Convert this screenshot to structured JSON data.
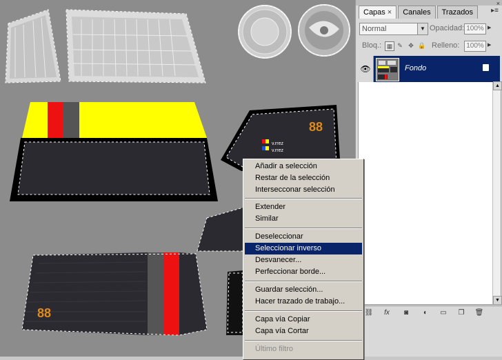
{
  "panel": {
    "tabs": [
      {
        "label": "Capas",
        "close": "×",
        "active": true
      },
      {
        "label": "Canales",
        "active": false
      },
      {
        "label": "Trazados",
        "active": false
      }
    ],
    "menu_glyph": "▸≡",
    "close_glyph": "×",
    "blend_mode": "Normal",
    "opacity_label": "Opacidad:",
    "opacity_value": "100%",
    "lock_label": "Bloq.:",
    "fill_label": "Relleno:",
    "fill_value": "100%",
    "layer": {
      "name": "Fondo",
      "visible": true,
      "locked": true
    },
    "bottom_icons": [
      "link-icon",
      "fx-icon",
      "mask-icon",
      "adjustment-icon",
      "group-icon",
      "new-layer-icon",
      "trash-icon"
    ]
  },
  "context_menu": {
    "items": [
      {
        "label": "Añadir a selección"
      },
      {
        "label": "Restar de la selección"
      },
      {
        "label": "Intersecconar selección"
      },
      {
        "sep": true
      },
      {
        "label": "Extender"
      },
      {
        "label": "Similar"
      },
      {
        "sep": true
      },
      {
        "label": "Deseleccionar"
      },
      {
        "label": "Seleccionar inverso",
        "highlighted": true
      },
      {
        "label": "Desvanecer..."
      },
      {
        "label": "Perfeccionar borde..."
      },
      {
        "sep": true
      },
      {
        "label": "Guardar selección..."
      },
      {
        "label": "Hacer trazado de trabajo..."
      },
      {
        "sep": true
      },
      {
        "label": "Capa vía Copiar"
      },
      {
        "label": "Capa vía Cortar"
      },
      {
        "sep": true
      },
      {
        "label": "Último filtro",
        "disabled": true
      }
    ]
  },
  "colors": {
    "canvas_bg": "#8c8c8c",
    "yellow": "#ffff00",
    "red": "#ee1111",
    "dark": "#2a2a30",
    "highlight": "#0a246a",
    "orange": "#e08a1a"
  }
}
